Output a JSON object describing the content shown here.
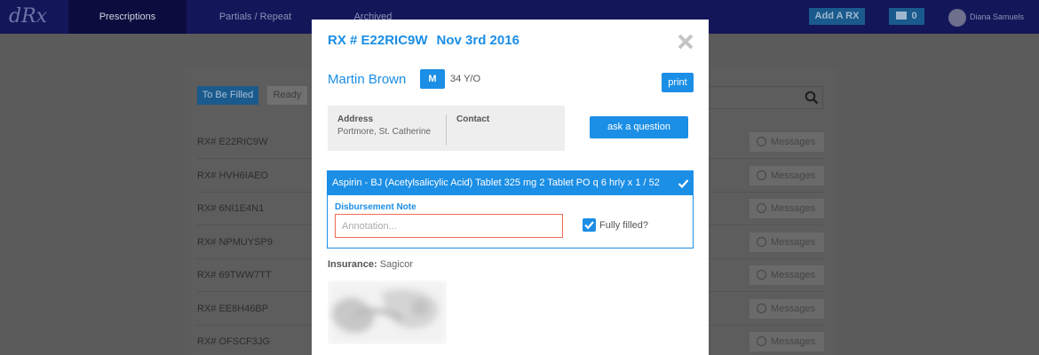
{
  "nav": {
    "logo": "dRx",
    "tabs": [
      "Prescriptions",
      "Partials / Repeat",
      "Archived"
    ],
    "add_rx": "Add A RX",
    "message_count": "0",
    "user_name": "Diana Samuels"
  },
  "list": {
    "filter_active": "To Be Filled",
    "filter_other": "Ready",
    "messages_label": "Messages",
    "rows": [
      {
        "rx": "RX# E22RIC9W"
      },
      {
        "rx": "RX# HVH6IAEO"
      },
      {
        "rx": "RX# 6NI1E4N1"
      },
      {
        "rx": "RX# NPMUYSP9"
      },
      {
        "rx": "RX# 69TWW7TT"
      },
      {
        "rx": "RX# EE8H46BP"
      },
      {
        "rx": "RX# OFSCF3JG"
      }
    ]
  },
  "modal": {
    "rx_number": "RX # E22RIC9W",
    "date": "Nov 3rd 2016",
    "patient_name": "Martin Brown",
    "gender": "M",
    "age": "34 Y/O",
    "print_label": "print",
    "address_label": "Address",
    "address_value": "Portmore, St. Catherine",
    "contact_label": "Contact",
    "contact_value": "",
    "ask_label": "ask a question",
    "drug": "Aspirin - BJ (Acetylsalicylic Acid) Tablet 325 mg 2 Tablet PO q 6 hrly x 1 / 52",
    "note_label": "Disbursement Note",
    "note_placeholder": "Annotation...",
    "note_value": "",
    "fully_filled_label": "Fully filled?",
    "fully_filled": true,
    "insurance_label": "Insurance:",
    "insurance_value": "Sagicor"
  },
  "colors": {
    "accent": "#1b8ee5",
    "nav_bg": "#14165a",
    "overlay": "#5b5b5b",
    "error_border": "#f06a55"
  }
}
